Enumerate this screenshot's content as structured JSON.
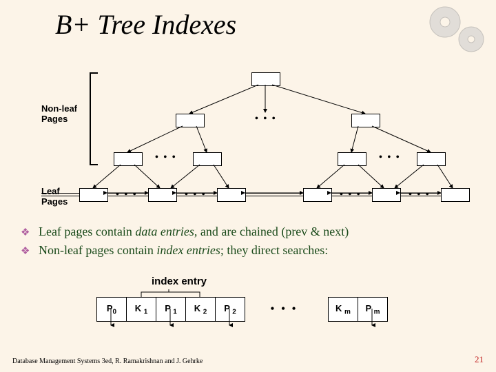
{
  "title": "B+ Tree Indexes",
  "labels": {
    "nonleaf": "Non-leaf\nPages",
    "leaf": "Leaf\nPages",
    "indexEntry": "index entry"
  },
  "bullets": [
    {
      "pre": "Leaf pages contain ",
      "em": "data entries",
      "post": ", and are chained (prev & next)"
    },
    {
      "pre": "Non-leaf pages contain ",
      "em": "index entries",
      "post": "; they direct searches:"
    }
  ],
  "indexCells": [
    "P0",
    "K 1",
    "P 1",
    "K 2",
    "P 2",
    "K m",
    "P m"
  ],
  "footer": "Database Management Systems 3ed, R. Ramakrishnan and J. Gehrke",
  "pageNumber": "21"
}
